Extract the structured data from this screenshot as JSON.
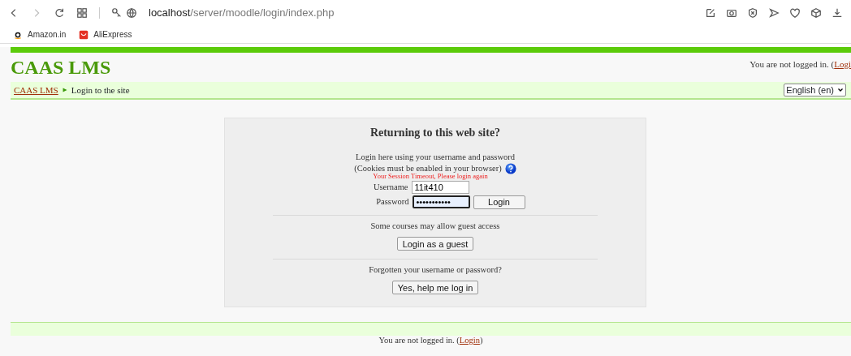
{
  "browser": {
    "url_host": "localhost",
    "url_path": "/server/moodle/login/index.php",
    "bookmarks": [
      {
        "label": "Amazon.in",
        "kind": "amazon"
      },
      {
        "label": "AliExpress",
        "kind": "aliexpress"
      }
    ]
  },
  "header": {
    "site_name": "CAAS LMS",
    "login_info": {
      "text": "You are not logged in. (",
      "link": "Logi"
    }
  },
  "navbar": {
    "breadcrumb": [
      {
        "label": "CAAS LMS",
        "kind": "link"
      },
      {
        "label": "Login to the site",
        "kind": "current"
      }
    ],
    "language": "English (en)"
  },
  "login_box": {
    "title": "Returning to this web site?",
    "intro": "Login here using your username and password",
    "cookies_note": "(Cookies must be enabled in your browser)",
    "error": "Your Session Timeout, Please login again",
    "fields": [
      {
        "label": "Username",
        "value": "11it410",
        "focused": false
      },
      {
        "label": "Password",
        "value": "•••••••••••",
        "focused": true
      }
    ],
    "login_button": "Login",
    "guest_text": "Some courses may allow guest access",
    "guest_button": "Login as a guest",
    "forgot_text": "Forgotten your username or password?",
    "forgot_button": "Yes, help me log in"
  },
  "footer": {
    "text": "You are not logged in. (",
    "link": "Login",
    "suffix": ")"
  }
}
